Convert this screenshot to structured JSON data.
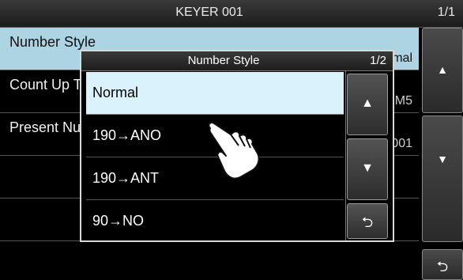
{
  "header": {
    "title": "KEYER 001",
    "page": "1/1"
  },
  "list": [
    {
      "label": "Number Style",
      "value": "Normal"
    },
    {
      "label": "Count Up Trigger",
      "value": "M5"
    },
    {
      "label": "Present Number",
      "value": "001"
    }
  ],
  "dialog": {
    "title": "Number Style",
    "page": "1/2",
    "options": [
      "Normal",
      "190→ANO",
      "190→ANT",
      "90→NO"
    ]
  },
  "buttons": {
    "up": "▲",
    "down": "▼",
    "back": "⮌"
  },
  "colors": {
    "selected_row": "#acd4e2",
    "selected_option": "#d9f2fb",
    "background": "#000000"
  }
}
